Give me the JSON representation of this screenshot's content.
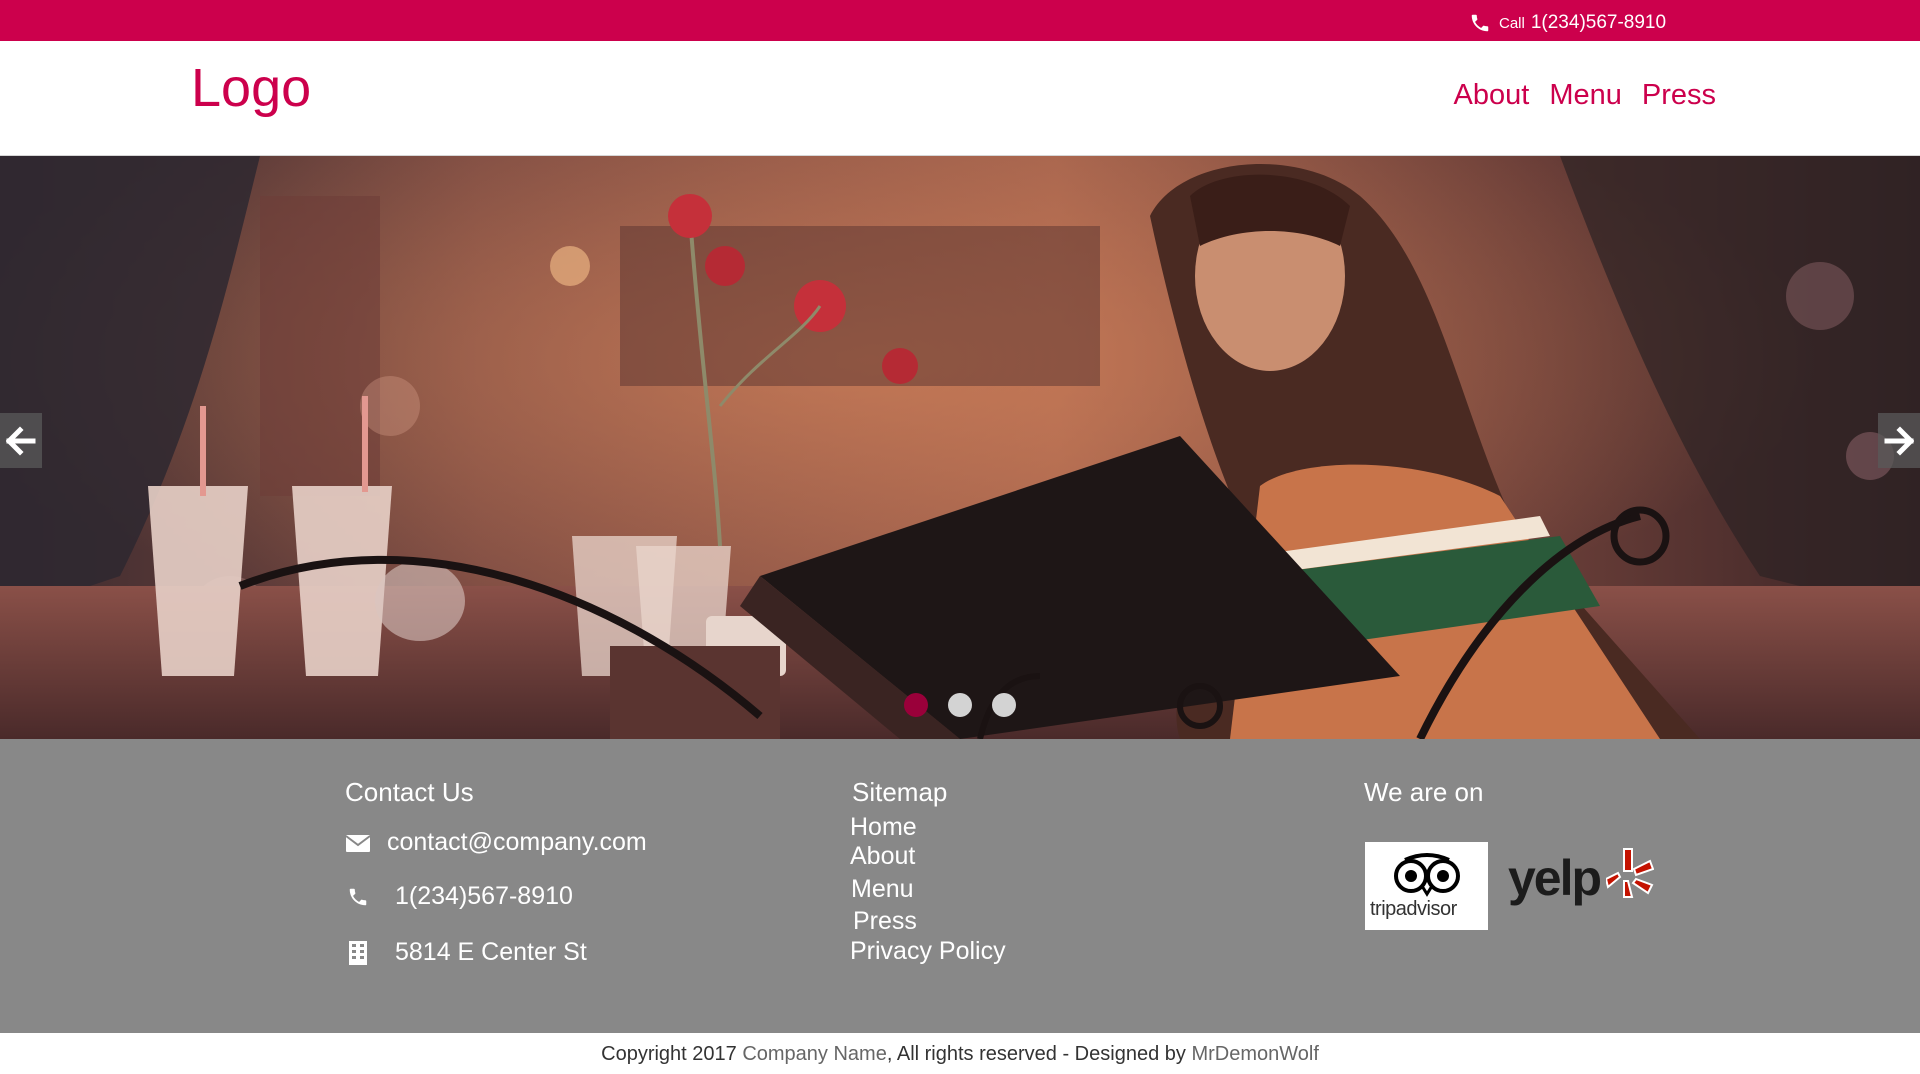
{
  "topbar": {
    "call_label": "Call",
    "call_number": "1(234)567-8910",
    "phone_icon": "phone-icon"
  },
  "header": {
    "logo": "Logo",
    "nav": [
      {
        "label": "About"
      },
      {
        "label": "Menu"
      },
      {
        "label": "Press"
      }
    ]
  },
  "hero": {
    "prev_icon": "arrow-left-icon",
    "next_icon": "arrow-right-icon",
    "slides_count": 3,
    "active_slide": 1
  },
  "footer": {
    "contact": {
      "title": "Contact Us",
      "email": "contact@company.com",
      "phone": "1(234)567-8910",
      "address": "5814 E Center St"
    },
    "sitemap": {
      "title": "Sitemap",
      "links": [
        {
          "label": "Home"
        },
        {
          "label": "About"
        },
        {
          "label": "Menu"
        },
        {
          "label": "Press"
        },
        {
          "label": "Privacy Policy"
        }
      ]
    },
    "social": {
      "title": "We are on",
      "tripadvisor_text": "tripadvisor",
      "yelp_text": "yelp"
    }
  },
  "copyright": {
    "prefix": "Copyright 2017 ",
    "company": "Company Name",
    "middle": ",  All rights reserved  - Designed by ",
    "designer": "MrDemonWolf"
  },
  "colors": {
    "brand": "#cc004c",
    "footer_bg": "#888888",
    "dot_active": "#9a003a"
  }
}
